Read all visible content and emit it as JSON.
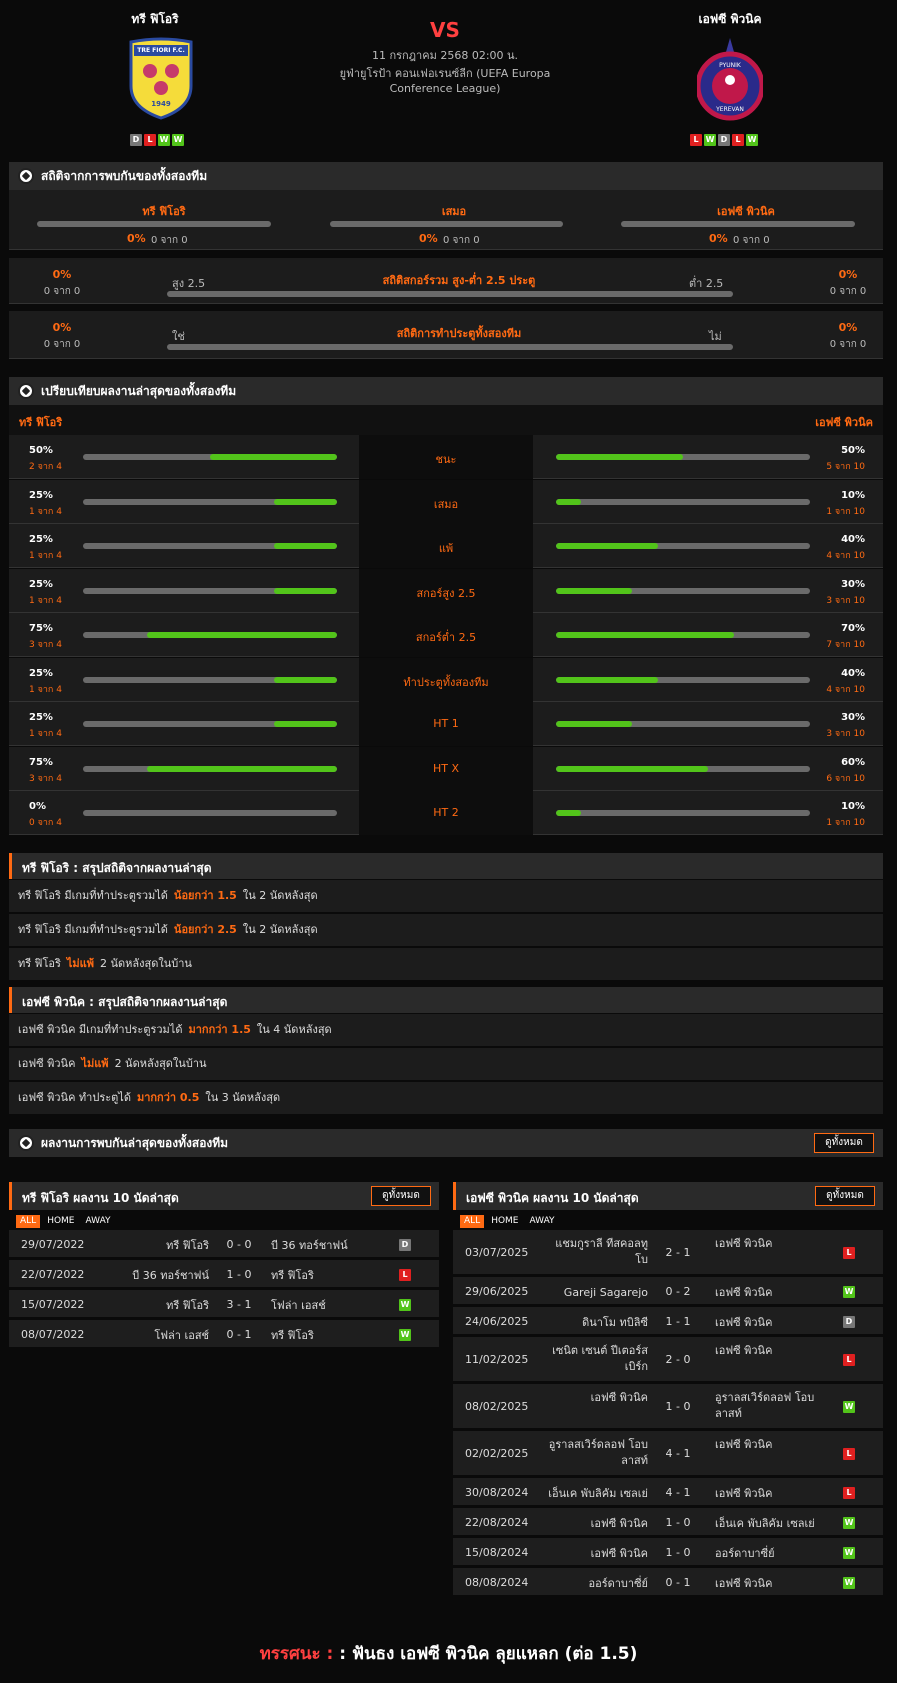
{
  "match": {
    "home": "ทรี ฟิโอริ",
    "away": "เอฟซี พิวนิค",
    "vs": "VS",
    "datetime": "11 กรกฎาคม 2568 02:00 น.",
    "league_line1": "ยูฟ่ายูโรป้า คอนเฟอเรนซ์ลีก (UEFA Europa",
    "league_line2": "Conference League)",
    "home_logo_text": "TRE FIORI F.C.",
    "home_logo_year": "1949",
    "away_logo_text": "PYUNIK",
    "away_logo_text2": "YEREVAN",
    "home_form": [
      "D",
      "L",
      "W",
      "W"
    ],
    "away_form": [
      "L",
      "W",
      "D",
      "L",
      "W"
    ]
  },
  "h2h": {
    "title": "สถิติจากการพบกันของทั้งสองทีม",
    "home": "ทรี ฟิโอริ",
    "draw": "เสมอ",
    "away": "เอฟซี พิวนิค",
    "home_pct": "0%",
    "home_of": "0 จาก 0",
    "draw_pct": "0%",
    "draw_of": "0 จาก 0",
    "away_pct": "0%",
    "away_of": "0 จาก 0",
    "ou": {
      "title": "สถิติสกอร์รวม สูง-ต่ำ 2.5 ประตู",
      "left": "สูง 2.5",
      "right": "ต่ำ 2.5",
      "lpct": "0%",
      "lof": "0 จาก 0",
      "rpct": "0%",
      "rof": "0 จาก 0"
    },
    "btts": {
      "title": "สถิติการทำประตูทั้งสองทีม",
      "left": "ใช่",
      "right": "ไม่",
      "lpct": "0%",
      "lof": "0 จาก 0",
      "rpct": "0%",
      "rof": "0 จาก 0"
    }
  },
  "compare": {
    "title": "เปรียบเทียบผลงานล่าสุดของทั้งสองทีม",
    "home": "ทรี ฟิโอริ",
    "away": "เอฟซี พิวนิค",
    "rows": [
      {
        "label": "ชนะ",
        "hp": "50%",
        "hof": "2 จาก 4",
        "hv": 0.5,
        "ap": "50%",
        "aof": "5 จาก 10",
        "av": 0.5
      },
      {
        "label": "เสมอ",
        "hp": "25%",
        "hof": "1 จาก 4",
        "hv": 0.25,
        "ap": "10%",
        "aof": "1 จาก 10",
        "av": 0.1
      },
      {
        "label": "แพ้",
        "hp": "25%",
        "hof": "1 จาก 4",
        "hv": 0.25,
        "ap": "40%",
        "aof": "4 จาก 10",
        "av": 0.4
      },
      {
        "label": "สกอร์สูง 2.5",
        "hp": "25%",
        "hof": "1 จาก 4",
        "hv": 0.25,
        "ap": "30%",
        "aof": "3 จาก 10",
        "av": 0.3
      },
      {
        "label": "สกอร์ต่ำ 2.5",
        "hp": "75%",
        "hof": "3 จาก 4",
        "hv": 0.75,
        "ap": "70%",
        "aof": "7 จาก 10",
        "av": 0.7
      },
      {
        "label": "ทำประตูทั้งสองทีม",
        "hp": "25%",
        "hof": "1 จาก 4",
        "hv": 0.25,
        "ap": "40%",
        "aof": "4 จาก 10",
        "av": 0.4
      },
      {
        "label": "HT 1",
        "hp": "25%",
        "hof": "1 จาก 4",
        "hv": 0.25,
        "ap": "30%",
        "aof": "3 จาก 10",
        "av": 0.3
      },
      {
        "label": "HT X",
        "hp": "75%",
        "hof": "3 จาก 4",
        "hv": 0.75,
        "ap": "60%",
        "aof": "6 จาก 10",
        "av": 0.6
      },
      {
        "label": "HT 2",
        "hp": "0%",
        "hof": "0 จาก 4",
        "hv": 0,
        "ap": "10%",
        "aof": "1 จาก 10",
        "av": 0.1
      }
    ]
  },
  "home_summary": {
    "title": "ทรี ฟิโอริ : สรุปสถิติจากผลงานล่าสุด",
    "lines": [
      {
        "pre": "ทรี ฟิโอริ  มีเกมที่ทำประตูรวมได้",
        "hl": "น้อยกว่า  1.5",
        "post": "ใน 2 นัดหลังสุด"
      },
      {
        "pre": "ทรี ฟิโอริ  มีเกมที่ทำประตูรวมได้",
        "hl": "น้อยกว่า  2.5",
        "post": "ใน 2 นัดหลังสุด"
      },
      {
        "pre": "ทรี ฟิโอริ",
        "hl": "ไม่แพ้",
        "post": "2  นัดหลังสุดในบ้าน"
      }
    ]
  },
  "away_summary": {
    "title": "เอฟซี พิวนิค : สรุปสถิติจากผลงานล่าสุด",
    "lines": [
      {
        "pre": "เอฟซี พิวนิค  มีเกมที่ทำประตูรวมได้",
        "hl": "มากกว่า  1.5",
        "post": "ใน 4 นัดหลังสุด"
      },
      {
        "pre": "เอฟซี พิวนิค",
        "hl": "ไม่แพ้",
        "post": "2  นัดหลังสุดในบ้าน"
      },
      {
        "pre": "เอฟซี พิวนิค  ทำประตูได้",
        "hl": "มากกว่า  0.5",
        "post": "ใน 3 นัดหลังสุด"
      }
    ]
  },
  "recent": {
    "title": "ผลงานการพบกันล่าสุดของทั้งสองทีม",
    "view_all": "ดูทั้งหมด",
    "filters": [
      "ALL",
      "HOME",
      "AWAY"
    ],
    "home_title": "ทรี ฟิโอริ ผลงาน 10 นัดล่าสุด",
    "away_title": "เอฟซี พิวนิค ผลงาน 10 นัดล่าสุด",
    "home_matches": [
      {
        "date": "29/07/2022",
        "home": "ทรี ฟิโอริ",
        "score": "0 - 0",
        "away": "บี 36 ทอร์ชาฟน์",
        "res": "D"
      },
      {
        "date": "22/07/2022",
        "home": "บี 36 ทอร์ชาฟน์",
        "score": "1 - 0",
        "away": "ทรี ฟิโอริ",
        "res": "L"
      },
      {
        "date": "15/07/2022",
        "home": "ทรี ฟิโอริ",
        "score": "3 - 1",
        "away": "โฟล่า เอสช์",
        "res": "W"
      },
      {
        "date": "08/07/2022",
        "home": "โฟล่า เอสช์",
        "score": "0 - 1",
        "away": "ทรี ฟิโอริ",
        "res": "W"
      }
    ],
    "away_matches": [
      {
        "date": "03/07/2025",
        "home": "แชมกูราลี ทีสคอลทูโบ",
        "score": "2 - 1",
        "away": "เอฟซี พิวนิค",
        "res": "L",
        "tall": true
      },
      {
        "date": "29/06/2025",
        "home": "Gareji Sagarejo",
        "score": "0 - 2",
        "away": "เอฟซี พิวนิค",
        "res": "W"
      },
      {
        "date": "24/06/2025",
        "home": "ดินาโม ทบิลิซี",
        "score": "1 - 1",
        "away": "เอฟซี พิวนิค",
        "res": "D"
      },
      {
        "date": "11/02/2025",
        "home": "เซนิต เซนต์ ปีเตอร์สเบิร์ก",
        "score": "2 - 0",
        "away": "เอฟซี พิวนิค",
        "res": "L",
        "tall": true
      },
      {
        "date": "08/02/2025",
        "home": "เอฟซี พิวนิค",
        "score": "1 - 0",
        "away": "อูราลสเวิร์ดลอฟ โอบลาสท์",
        "res": "W",
        "tall": true
      },
      {
        "date": "02/02/2025",
        "home": "อูราลสเวิร์ดลอฟ โอบลาสท์",
        "score": "4 - 1",
        "away": "เอฟซี พิวนิค",
        "res": "L",
        "tall": true
      },
      {
        "date": "30/08/2024",
        "home": "เอ็นเค พับลิคัม เซลเย่",
        "score": "4 - 1",
        "away": "เอฟซี พิวนิค",
        "res": "L"
      },
      {
        "date": "22/08/2024",
        "home": "เอฟซี พิวนิค",
        "score": "1 - 0",
        "away": "เอ็นเค พับลิคัม เซลเย่",
        "res": "W"
      },
      {
        "date": "15/08/2024",
        "home": "เอฟซี พิวนิค",
        "score": "1 - 0",
        "away": "ออร์ดาบาซี่ย์",
        "res": "W"
      },
      {
        "date": "08/08/2024",
        "home": "ออร์ดาบาซี่ย์",
        "score": "0 - 1",
        "away": "เอฟซี พิวนิค",
        "res": "W"
      }
    ]
  },
  "prediction": {
    "label": "ทรรศนะ :",
    "text": " :  ฟันธง เอฟซี พิวนิค ลุยแหลก (ต่อ 1.5)"
  }
}
